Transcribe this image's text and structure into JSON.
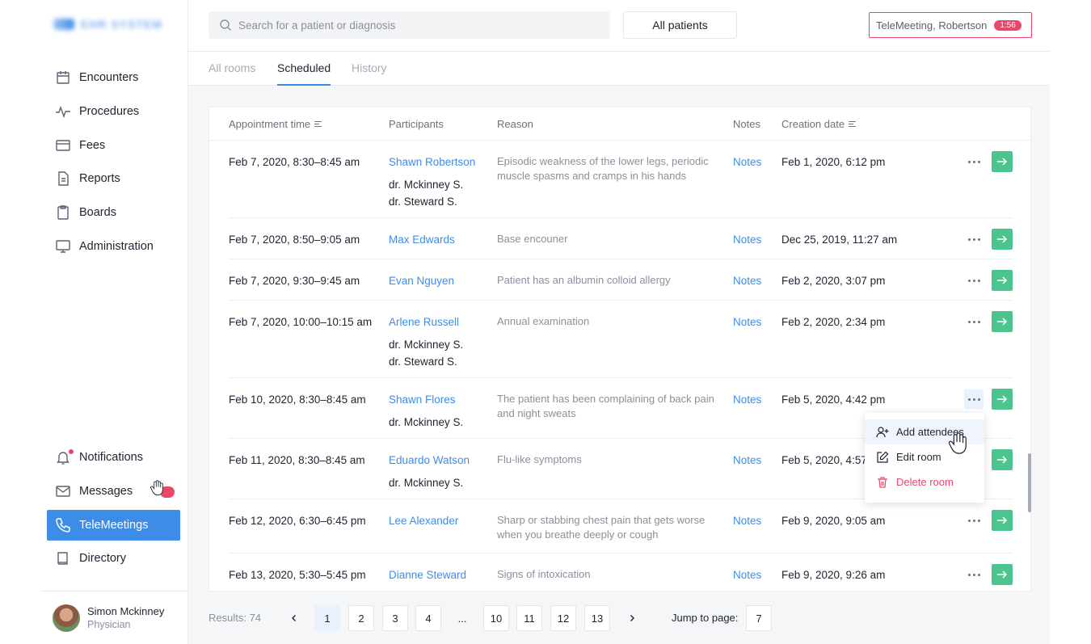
{
  "app": {
    "logo_text": "EHR SYSTEM"
  },
  "sidebar": {
    "items": [
      {
        "label": "Encounters",
        "icon": "calendar-icon"
      },
      {
        "label": "Procedures",
        "icon": "activity-icon"
      },
      {
        "label": "Fees",
        "icon": "credit-card-icon"
      },
      {
        "label": "Reports",
        "icon": "document-icon"
      },
      {
        "label": "Boards",
        "icon": "clipboard-icon"
      },
      {
        "label": "Administration",
        "icon": "monitor-icon"
      }
    ],
    "bottom_items": [
      {
        "label": "Notifications",
        "icon": "bell-icon"
      },
      {
        "label": "Messages",
        "icon": "mail-icon"
      },
      {
        "label": "TeleMeetings",
        "icon": "phone-icon",
        "active": true
      },
      {
        "label": "Directory",
        "icon": "book-icon"
      }
    ],
    "profile": {
      "name": "Simon Mckinney",
      "role": "Physician"
    }
  },
  "topbar": {
    "search_placeholder": "Search for a patient or diagnosis",
    "filter_label": "All patients",
    "active_meeting": {
      "label": "TeleMeeting, Robertson",
      "timer": "1:56"
    }
  },
  "tabs": [
    {
      "label": "All rooms"
    },
    {
      "label": "Scheduled",
      "active": true
    },
    {
      "label": "History"
    }
  ],
  "table": {
    "headers": {
      "time": "Appointment time",
      "participants": "Participants",
      "reason": "Reason",
      "notes": "Notes",
      "created": "Creation date"
    },
    "rows": [
      {
        "time": "Feb 7, 2020, 8:30–8:45 am",
        "patient": "Shawn Robertson",
        "doc1": "dr. Mckinney S.",
        "doc2": "dr. Steward S.",
        "reason": "Episodic weakness of the lower legs, periodic muscle spasms and cramps in his hands",
        "notes": "Notes",
        "created": "Feb 1, 2020, 6:12 pm"
      },
      {
        "time": "Feb 7, 2020, 8:50–9:05 am",
        "patient": "Max Edwards",
        "doc1": "",
        "doc2": "",
        "reason": "Base encouner",
        "notes": "Notes",
        "created": "Dec 25, 2019, 11:27 am"
      },
      {
        "time": "Feb 7, 2020, 9:30–9:45 am",
        "patient": "Evan Nguyen",
        "doc1": "",
        "doc2": "",
        "reason": "Patient has an albumin colloid allergy",
        "notes": "Notes",
        "created": "Feb 2, 2020, 3:07 pm"
      },
      {
        "time": "Feb 7, 2020, 10:00–10:15 am",
        "patient": "Arlene Russell",
        "doc1": "dr. Mckinney S.",
        "doc2": "dr. Steward S.",
        "reason": "Annual examination",
        "notes": "Notes",
        "created": "Feb 2, 2020, 2:34 pm"
      },
      {
        "time": "Feb 10, 2020, 8:30–8:45 am",
        "patient": "Shawn Flores",
        "doc1": "dr. Mckinney S.",
        "doc2": "",
        "reason": "The patient has been complaining of back pain and night sweats",
        "notes": "Notes",
        "created": "Feb 5, 2020, 4:42 pm"
      },
      {
        "time": "Feb 11, 2020, 8:30–8:45 am",
        "patient": "Eduardo Watson",
        "doc1": "dr. Mckinney S.",
        "doc2": "",
        "reason": "Flu-like symptoms",
        "notes": "Notes",
        "created": "Feb 5, 2020, 4:57 pm"
      },
      {
        "time": "Feb 12, 2020, 6:30–6:45 pm",
        "patient": "Lee Alexander",
        "doc1": "",
        "doc2": "",
        "reason": "Sharp or stabbing chest pain that gets worse when you breathe deeply or cough",
        "notes": "Notes",
        "created": "Feb 9, 2020, 9:05 am"
      },
      {
        "time": "Feb 13, 2020, 5:30–5:45 pm",
        "patient": "Dianne Steward",
        "doc1": "",
        "doc2": "",
        "reason": "Signs of intoxication",
        "notes": "Notes",
        "created": "Feb 9, 2020, 9:26 am"
      }
    ]
  },
  "row_menu": {
    "items": [
      {
        "label": "Add attendees",
        "icon": "add-user-icon"
      },
      {
        "label": "Edit room",
        "icon": "edit-icon"
      },
      {
        "label": "Delete room",
        "icon": "trash-icon",
        "danger": true
      }
    ]
  },
  "pagination": {
    "results": "Results: 74",
    "pages": [
      "1",
      "2",
      "3",
      "4",
      "...",
      "10",
      "11",
      "12",
      "13"
    ],
    "current": "1",
    "jump_label": "Jump to page:",
    "jump_value": "7"
  },
  "colors": {
    "accent": "#3d8de8",
    "go": "#4cc48e",
    "danger": "#e8486a"
  }
}
